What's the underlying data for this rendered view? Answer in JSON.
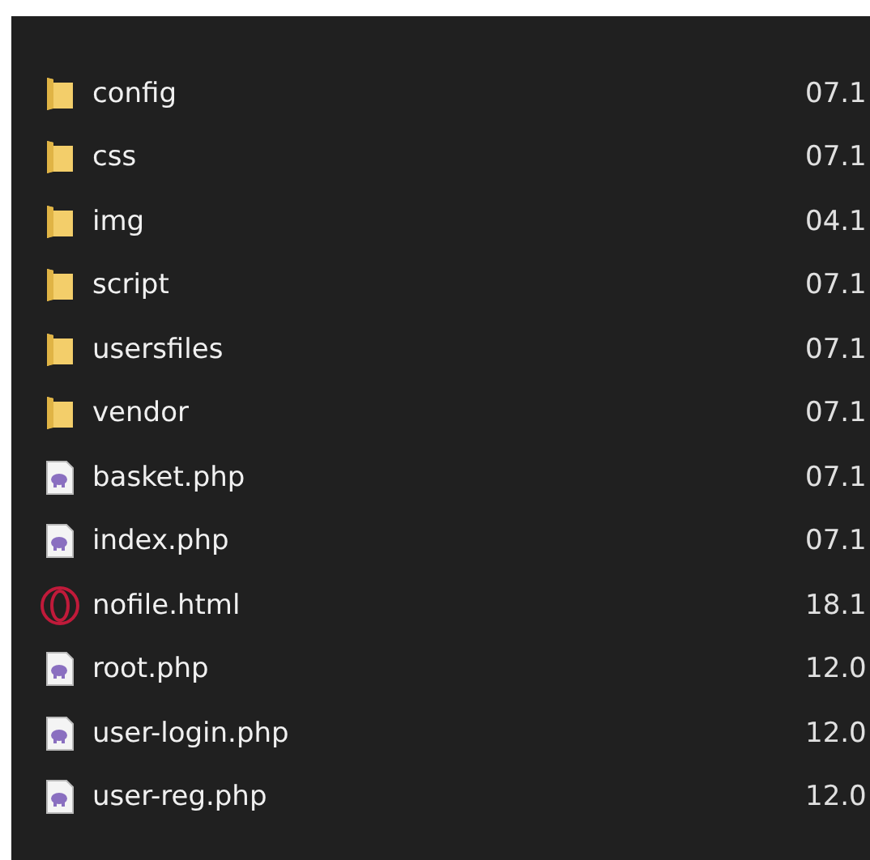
{
  "files": [
    {
      "name": "config",
      "kind": "folder",
      "date": "07.1"
    },
    {
      "name": "css",
      "kind": "folder",
      "date": "07.1"
    },
    {
      "name": "img",
      "kind": "folder",
      "date": "04.1"
    },
    {
      "name": "script",
      "kind": "folder",
      "date": "07.1"
    },
    {
      "name": "usersfiles",
      "kind": "folder",
      "date": "07.1"
    },
    {
      "name": "vendor",
      "kind": "folder",
      "date": "07.1"
    },
    {
      "name": "basket.php",
      "kind": "php",
      "date": "07.1"
    },
    {
      "name": "index.php",
      "kind": "php",
      "date": "07.1"
    },
    {
      "name": "nofile.html",
      "kind": "html",
      "date": "18.1"
    },
    {
      "name": "root.php",
      "kind": "php",
      "date": "12.0"
    },
    {
      "name": "user-login.php",
      "kind": "php",
      "date": "12.0"
    },
    {
      "name": "user-reg.php",
      "kind": "php",
      "date": "12.0"
    }
  ]
}
